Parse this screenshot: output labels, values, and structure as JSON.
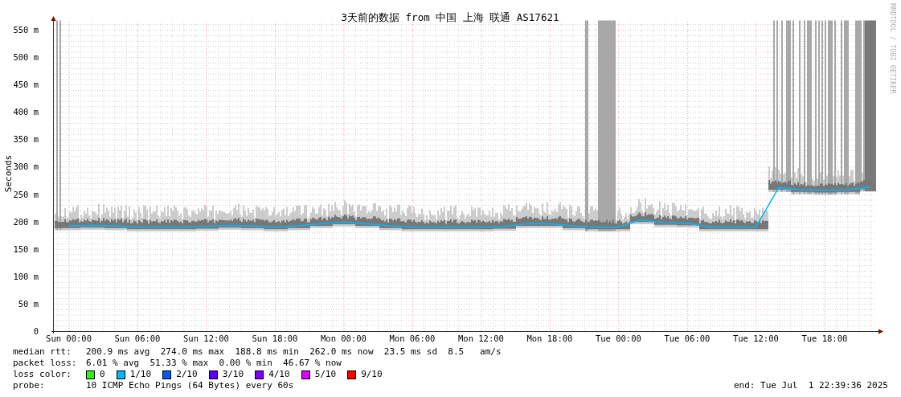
{
  "graph": {
    "title": "3天前的数据 from 中国 上海 联通 AS17621",
    "signature": "RRDTOOL / TOBI OETIKER",
    "chart_data": {
      "type": "line",
      "grid": true,
      "ylabel": "Seconds",
      "ylim": [
        0,
        575
      ],
      "categories": [
        "Sun 00:00",
        null,
        null,
        "Sun 06:00",
        null,
        null,
        "Sun 12:00",
        null,
        null,
        "Sun 18:00",
        null,
        null,
        "Mon 00:00",
        null,
        null,
        "Mon 06:00",
        null,
        null,
        "Mon 12:00",
        null,
        null,
        "Mon 18:00",
        null,
        null,
        "Tue 00:00",
        null,
        null,
        "Tue 06:00",
        null,
        null,
        "Tue 12:00",
        null,
        null,
        "Tue 18:00",
        null,
        null
      ],
      "yticks": [
        {
          "value": 0,
          "label": "0"
        },
        {
          "value": 50,
          "label": "50 m"
        },
        {
          "value": 100,
          "label": "100 m"
        },
        {
          "value": 150,
          "label": "150 m"
        },
        {
          "value": 200,
          "label": "200 m"
        },
        {
          "value": 250,
          "label": "250 m"
        },
        {
          "value": 300,
          "label": "300 m"
        },
        {
          "value": 350,
          "label": "350 m"
        },
        {
          "value": 400,
          "label": "400 m"
        },
        {
          "value": 450,
          "label": "450 m"
        },
        {
          "value": 500,
          "label": "500 m"
        },
        {
          "value": 550,
          "label": "550 m"
        }
      ],
      "series": [
        {
          "color": "#00b8ff",
          "values": [
            192,
            193,
            192,
            190,
            190,
            190,
            191,
            193,
            192,
            190,
            192,
            196,
            199,
            196,
            192,
            190,
            190,
            190,
            190,
            191,
            196,
            196,
            192,
            190,
            190,
            203,
            198,
            197,
            190,
            190,
            190,
            262,
            258,
            257,
            258,
            263
          ]
        }
      ]
    }
  },
  "legend": {
    "rows": [
      {
        "kind": "text",
        "label": "median rtt:",
        "value": "200.9 ms avg  274.0 ms max  188.8 ms min  262.0 ms now  23.5 ms sd  8.5   am/s"
      },
      {
        "kind": "text",
        "label": "packet loss:",
        "value": "6.01 % avg  51.33 % max  0.00 % min  46.67 % now"
      },
      {
        "kind": "swatches",
        "label": "loss color:",
        "items": [
          {
            "label": "0",
            "color": "#26ff00"
          },
          {
            "label": "1/10",
            "color": "#00b8ff"
          },
          {
            "label": "2/10",
            "color": "#0059ff"
          },
          {
            "label": "3/10",
            "color": "#5e00ff"
          },
          {
            "label": "4/10",
            "color": "#7e00ff"
          },
          {
            "label": "5/10",
            "color": "#dd00ff"
          },
          {
            "label": "9/10",
            "color": "#ff0000"
          }
        ]
      },
      {
        "kind": "text",
        "label": "probe:",
        "value": "10 ICMP Echo Pings (64 Bytes) every 60s"
      }
    ],
    "end": "end: Tue Jul  1 22:39:36 2025"
  }
}
